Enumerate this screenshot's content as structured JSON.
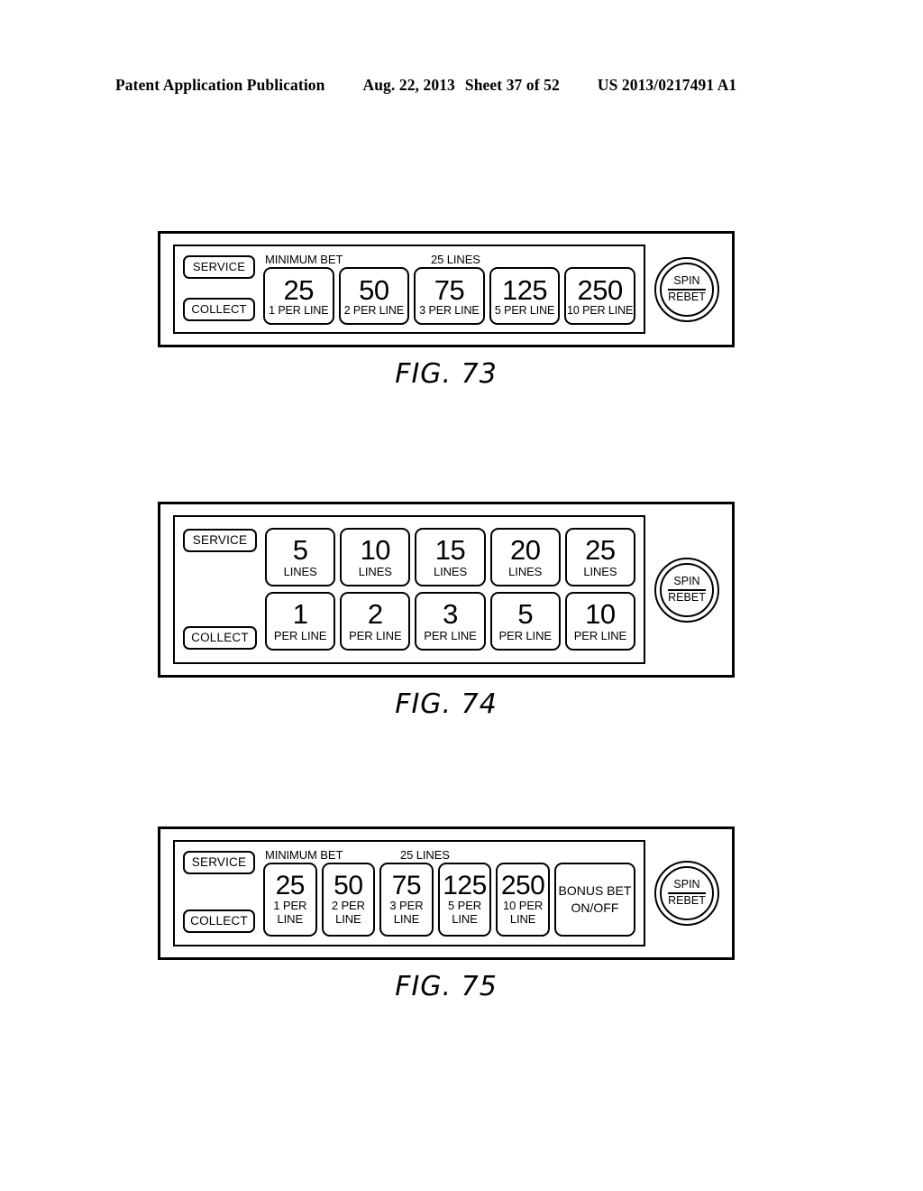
{
  "header": {
    "publication": "Patent Application Publication",
    "date": "Aug. 22, 2013",
    "sheet": "Sheet 37 of 52",
    "patent_number": "US 2013/0217491 A1"
  },
  "figures": [
    {
      "id": "fig-73",
      "caption": "FIG. 73",
      "service_label": "SERVICE",
      "collect_label": "COLLECT",
      "labels": {
        "minimum_bet": "MINIMUM BET",
        "lines": "25 LINES"
      },
      "bet_buttons": [
        {
          "value": "25",
          "sub": "1 PER LINE"
        },
        {
          "value": "50",
          "sub": "2 PER LINE"
        },
        {
          "value": "75",
          "sub": "3 PER LINE"
        },
        {
          "value": "125",
          "sub": "5 PER LINE"
        },
        {
          "value": "250",
          "sub": "10 PER LINE"
        }
      ],
      "spin": {
        "top": "SPIN",
        "bottom": "REBET"
      }
    },
    {
      "id": "fig-74",
      "caption": "FIG. 74",
      "service_label": "SERVICE",
      "collect_label": "COLLECT",
      "lines_buttons": [
        {
          "value": "5",
          "sub": "LINES"
        },
        {
          "value": "10",
          "sub": "LINES"
        },
        {
          "value": "15",
          "sub": "LINES"
        },
        {
          "value": "20",
          "sub": "LINES"
        },
        {
          "value": "25",
          "sub": "LINES"
        }
      ],
      "perline_buttons": [
        {
          "value": "1",
          "sub": "PER LINE"
        },
        {
          "value": "2",
          "sub": "PER LINE"
        },
        {
          "value": "3",
          "sub": "PER LINE"
        },
        {
          "value": "5",
          "sub": "PER LINE"
        },
        {
          "value": "10",
          "sub": "PER LINE"
        }
      ],
      "spin": {
        "top": "SPIN",
        "bottom": "REBET"
      }
    },
    {
      "id": "fig-75",
      "caption": "FIG. 75",
      "service_label": "SERVICE",
      "collect_label": "COLLECT",
      "labels": {
        "minimum_bet": "MINIMUM BET",
        "lines": "25 LINES"
      },
      "bet_buttons": [
        {
          "value": "25",
          "sub1": "1 PER",
          "sub2": "LINE"
        },
        {
          "value": "50",
          "sub1": "2 PER",
          "sub2": "LINE"
        },
        {
          "value": "75",
          "sub1": "3 PER",
          "sub2": "LINE"
        },
        {
          "value": "125",
          "sub1": "5 PER",
          "sub2": "LINE"
        },
        {
          "value": "250",
          "sub1": "10 PER",
          "sub2": "LINE"
        }
      ],
      "bonus_button": {
        "line1": "BONUS BET",
        "line2": "ON/OFF"
      },
      "spin": {
        "top": "SPIN",
        "bottom": "REBET"
      }
    }
  ]
}
